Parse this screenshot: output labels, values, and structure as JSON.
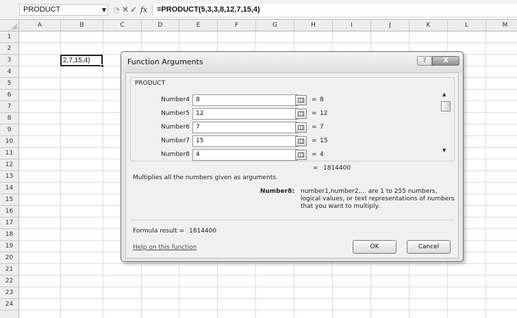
{
  "formula_bar": {
    "name_box": "PRODUCT",
    "formula": "=PRODUCT(5,3,3,8,12,7,15,4)"
  },
  "columns": [
    "A",
    "B",
    "C",
    "D",
    "E",
    "F",
    "G",
    "H",
    "I",
    "J",
    "K",
    "L",
    "M"
  ],
  "rows": [
    "1",
    "2",
    "3",
    "4",
    "5",
    "6",
    "7",
    "8",
    "9",
    "10",
    "11",
    "12",
    "13",
    "14",
    "15",
    "16",
    "17",
    "18",
    "19",
    "20",
    "21",
    "22",
    "23",
    "24"
  ],
  "active_cell": {
    "text": "2,7,15,4)"
  },
  "dialog": {
    "title": "Function Arguments",
    "help_button": "?",
    "close_button": "X",
    "function_name": "PRODUCT",
    "arguments": [
      {
        "label": "Number4",
        "value": "8",
        "result": "8"
      },
      {
        "label": "Number5",
        "value": "12",
        "result": "12"
      },
      {
        "label": "Number6",
        "value": "7",
        "result": "7"
      },
      {
        "label": "Number7",
        "value": "15",
        "result": "15"
      },
      {
        "label": "Number8",
        "value": "4",
        "result": "4"
      }
    ],
    "equals": "=",
    "total_result": "1814400",
    "description": "Multiplies all the numbers given as arguments.",
    "current_arg_name": "Number8:",
    "current_arg_desc": "number1,number2,... are 1 to 255 numbers, logical values, or text representations of numbers that you want to multiply.",
    "formula_result_label": "Formula result =",
    "formula_result_value": "1814400",
    "help_link": "Help on this function",
    "ok_label": "OK",
    "cancel_label": "Cancel"
  }
}
